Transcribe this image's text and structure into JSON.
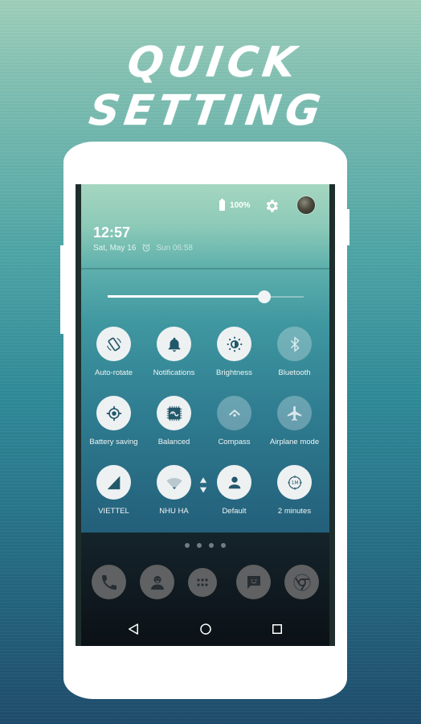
{
  "headline": "QUICK SETTING",
  "status_bar": {
    "battery_text": "100%",
    "settings_icon": "gear-icon",
    "avatar_icon": "user-avatar"
  },
  "header": {
    "time": "12:57",
    "date": "Sat, May 16",
    "alarm_time": "Sun 06:58"
  },
  "brightness_slider": {
    "value_fraction": 0.8
  },
  "tiles": [
    {
      "label": "Auto-rotate",
      "icon": "rotate-icon",
      "active": true
    },
    {
      "label": "Notifications",
      "icon": "bell-icon",
      "active": true
    },
    {
      "label": "Brightness",
      "icon": "brightness-icon",
      "active": true
    },
    {
      "label": "Bluetooth",
      "icon": "bluetooth-icon",
      "active": false
    },
    {
      "label": "Battery saving",
      "icon": "crosshair-icon",
      "active": true
    },
    {
      "label": "Balanced",
      "icon": "cpu-chip-icon",
      "active": true
    },
    {
      "label": "Compass",
      "icon": "location-icon",
      "active": false
    },
    {
      "label": "Airplane mode",
      "icon": "airplane-icon",
      "active": false
    },
    {
      "label": "VIETTEL",
      "icon": "cell-signal-icon",
      "active": true
    },
    {
      "label": "NHU HA",
      "icon": "wifi-icon",
      "active": true
    },
    {
      "label": "Default",
      "icon": "person-icon",
      "active": true
    },
    {
      "label": "2 minutes",
      "icon": "timeout-icon",
      "active": true,
      "badge": "1M"
    }
  ],
  "page_indicator": {
    "pages": 4
  },
  "dock": [
    {
      "icon": "phone-icon",
      "label": "Phone"
    },
    {
      "icon": "contacts-icon",
      "label": "Contacts"
    },
    {
      "icon": "app-drawer-icon",
      "label": "Apps"
    },
    {
      "icon": "messaging-icon",
      "label": "Messaging"
    },
    {
      "icon": "chrome-icon",
      "label": "Chrome"
    }
  ],
  "nav_bar": [
    "back",
    "home",
    "recents"
  ],
  "colors": {
    "tile_on": "#eef1f2",
    "tile_glyph": "#21586a",
    "dock_icon_bg": "#5f6162"
  }
}
